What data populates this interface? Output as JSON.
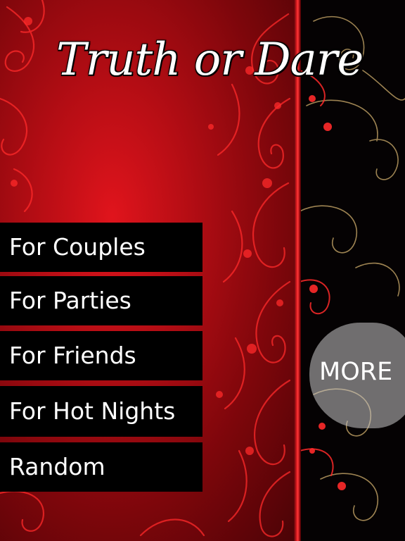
{
  "app": {
    "title": "Truth or Dare"
  },
  "menu": {
    "items": [
      {
        "id": "couples",
        "label": "For Couples"
      },
      {
        "id": "parties",
        "label": "For Parties"
      },
      {
        "id": "friends",
        "label": "For Friends"
      },
      {
        "id": "hot-nights",
        "label": "For Hot Nights"
      },
      {
        "id": "random",
        "label": "Random"
      }
    ]
  },
  "more": {
    "label": "MORE"
  },
  "colors": {
    "red_center": "#e0141c",
    "red_edge": "#4a0306",
    "panel_black": "#050203",
    "button_black": "#000000",
    "text_white": "#ffffff",
    "ornament_red": "#ff2a2a",
    "ornament_gold": "#b89a60"
  },
  "icons": {
    "ornament": "floral-swirl-ornament"
  }
}
